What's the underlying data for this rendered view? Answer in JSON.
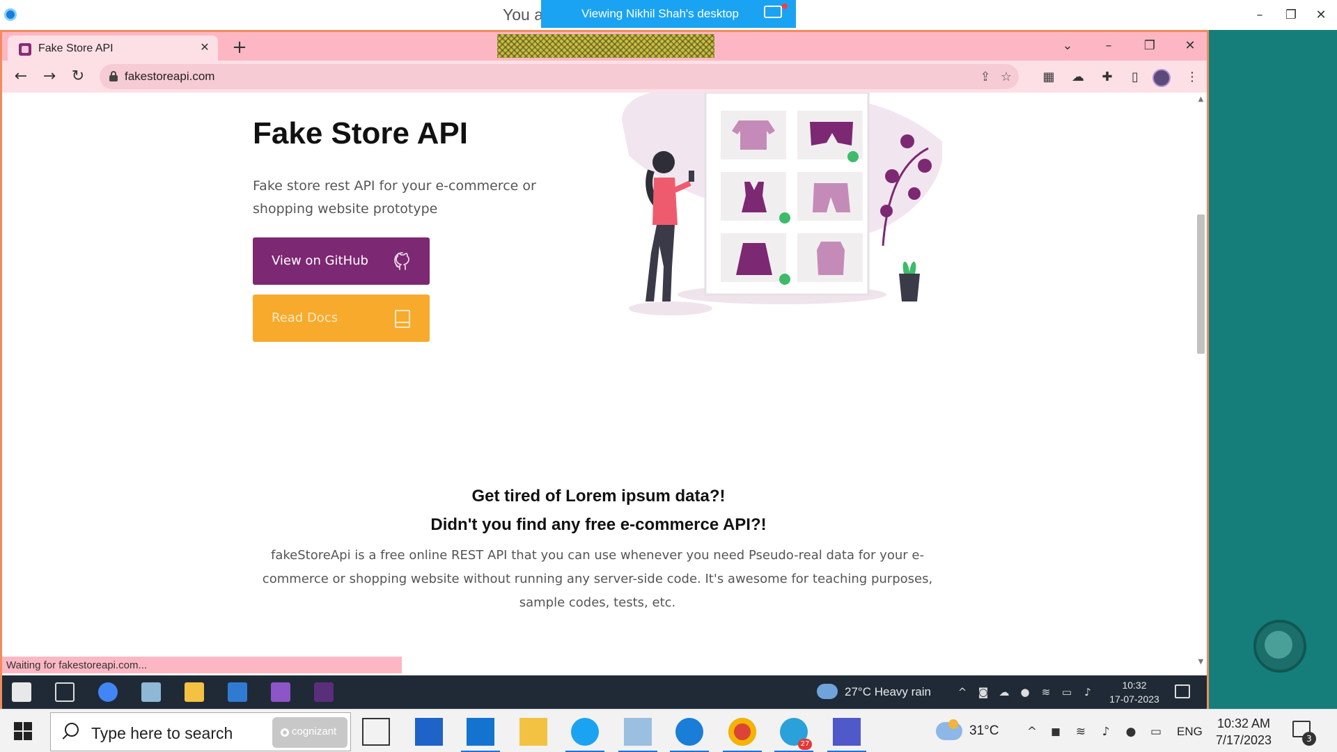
{
  "viewer": {
    "title_partial": "You a",
    "banner_text": "Viewing Nikhil Shah's desktop",
    "minimize": "–",
    "restore": "❐",
    "close": "✕"
  },
  "browser": {
    "tab_title": "Fake Store API",
    "tab_close": "✕",
    "new_tab": "+",
    "tab_search": "⌄",
    "win_minimize": "–",
    "win_restore": "❐",
    "win_close": "✕",
    "nav": {
      "back": "←",
      "forward": "→",
      "reload": "↻"
    },
    "url": "fakestoreapi.com",
    "status_text": "Waiting for fakestoreapi.com..."
  },
  "page": {
    "hero_title": "Fake Store API",
    "hero_subtitle": "Fake store rest API for your e-commerce or shopping website prototype",
    "github_button": "View on GitHub",
    "docs_button": "Read Docs",
    "section_heading_1": "Get tired of Lorem ipsum data?!",
    "section_heading_2": "Didn't you find any free e-commerce API?!",
    "section_paragraph": "fakeStoreApi is a free online REST API that you can use whenever you need Pseudo-real data for your e-commerce or shopping website without running any server-side code. It's awesome for teaching purposes, sample codes, tests, etc."
  },
  "remote_taskbar": {
    "weather": "27°C  Heavy rain",
    "time": "10:32",
    "date": "17-07-2023"
  },
  "taskbar": {
    "search_placeholder": "Type here to search",
    "cognizant_label": "cognizant",
    "telegram_badge": "27",
    "temperature": "31°C",
    "language": "ENG",
    "time": "10:32 AM",
    "date": "7/17/2023",
    "notification_count": "3"
  },
  "colors": {
    "github_button": "#7d2872",
    "docs_button": "#f8aa2c",
    "tabstrip": "#fdb7c4",
    "remote_background": "#167e7a",
    "viewer_banner": "#1aa3f2"
  }
}
